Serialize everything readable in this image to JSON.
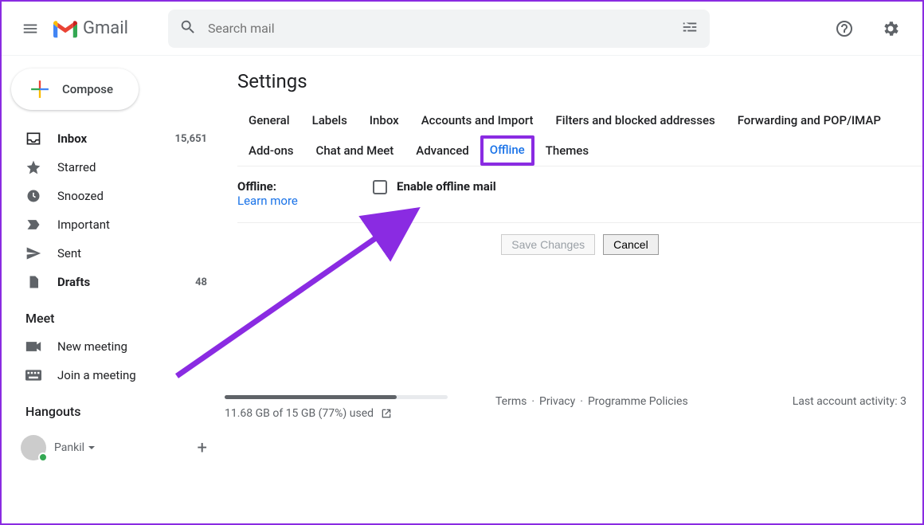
{
  "header": {
    "app_name": "Gmail",
    "search_placeholder": "Search mail"
  },
  "sidebar": {
    "compose_label": "Compose",
    "items": [
      {
        "label": "Inbox",
        "count": "15,651",
        "bold": true,
        "icon": "inbox"
      },
      {
        "label": "Starred",
        "count": "",
        "bold": false,
        "icon": "star"
      },
      {
        "label": "Snoozed",
        "count": "",
        "bold": false,
        "icon": "clock"
      },
      {
        "label": "Important",
        "count": "",
        "bold": false,
        "icon": "important"
      },
      {
        "label": "Sent",
        "count": "",
        "bold": false,
        "icon": "sent"
      },
      {
        "label": "Drafts",
        "count": "48",
        "bold": true,
        "icon": "drafts"
      }
    ],
    "meet": {
      "title": "Meet",
      "new_meeting": "New meeting",
      "join_meeting": "Join a meeting"
    },
    "hangouts": {
      "title": "Hangouts",
      "user": "Pankil"
    }
  },
  "settings": {
    "title": "Settings",
    "tabs": [
      "General",
      "Labels",
      "Inbox",
      "Accounts and Import",
      "Filters and blocked addresses",
      "Forwarding and POP/IMAP",
      "Add-ons",
      "Chat and Meet",
      "Advanced",
      "Offline",
      "Themes"
    ],
    "active_tab": "Offline",
    "offline": {
      "label": "Offline:",
      "learn_more": "Learn more",
      "checkbox_label": "Enable offline mail"
    },
    "buttons": {
      "save": "Save Changes",
      "cancel": "Cancel"
    }
  },
  "footer": {
    "storage_percent": 77,
    "storage_text": "11.68 GB of 15 GB (77%) used",
    "links": [
      "Terms",
      "Privacy",
      "Programme Policies"
    ],
    "activity": "Last account activity: 3"
  },
  "annotation": {
    "arrow_color": "#8a2be2"
  }
}
